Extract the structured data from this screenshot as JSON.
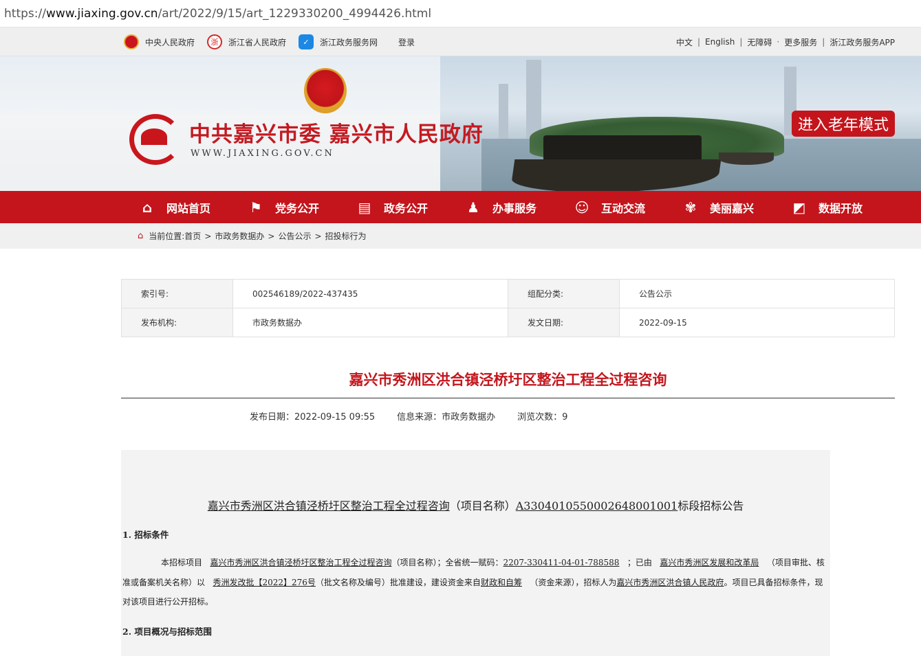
{
  "browser": {
    "url_prefix": "https://",
    "url_host": "www.jiaxing.gov.cn",
    "url_path": "/art/2022/9/15/art_1229330200_4994426.html"
  },
  "topbar": {
    "left_links": [
      "中央人民政府",
      "浙江省人民政府",
      "浙江政务服务网",
      "登录"
    ],
    "right_links": [
      "中文",
      "English",
      "无障碍",
      "更多服务",
      "浙江政务服务APP"
    ],
    "separators": [
      "|",
      "|",
      "·",
      "|"
    ]
  },
  "banner": {
    "title": "中共嘉兴市委 嘉兴市人民政府",
    "domain": "WWW.JIAXING.GOV.CN",
    "senior_mode": "进入老年模式"
  },
  "nav": {
    "items": [
      "网站首页",
      "党务公开",
      "政务公开",
      "办事服务",
      "互动交流",
      "美丽嘉兴",
      "数据开放"
    ]
  },
  "breadcrumb": {
    "prefix": "当前位置:首页",
    "items": [
      "市政务数据办",
      "公告公示",
      "招投标行为"
    ],
    "sep": ">"
  },
  "meta": {
    "index_label": "索引号:",
    "index_value": "002546189/2022-437435",
    "category_label": "组配分类:",
    "category_value": "公告公示",
    "org_label": "发布机构:",
    "org_value": "市政务数据办",
    "date_label": "发文日期:",
    "date_value": "2022-09-15"
  },
  "article": {
    "title": "嘉兴市秀洲区洪合镇泾桥圩区整治工程全过程咨询",
    "publish": "发布日期：2022-09-15 09:55",
    "source": "信息来源：市政务数据办",
    "views": "浏览次数：9"
  },
  "content": {
    "heading_underlined": "嘉兴市秀洲区洪合镇泾桥圩区整治工程全过程咨询",
    "heading_mid": "（项目名称）",
    "heading_code": "A3304010550002648001001",
    "heading_tail": "标段招标公告",
    "section1": "1.   招标条件",
    "p_a": "本招标项目",
    "p_project": "嘉兴市秀洲区洪合镇泾桥圩区整治工程全过程咨询",
    "p_b": "（项目名称）；全省统一赋码：",
    "p_code": "2207-330411-04-01-788588",
    "p_c": "；已由",
    "p_dept": "嘉兴市秀洲区发展和改革局",
    "p_d": "（项目审批、核准或备案机关名称）以",
    "p_doc": "秀洲发改批【2022】276号",
    "p_e": "（批文名称及编号）批准建设，建设资金来自",
    "p_fund": "财政和自筹",
    "p_f": "（资金来源），招标人为",
    "p_owner": "嘉兴市秀洲区洪合镇人民政府",
    "p_g": "。项目已具备招标条件，现对该项目进行公开招标。",
    "section2": "2.   项目概况与招标范围"
  }
}
